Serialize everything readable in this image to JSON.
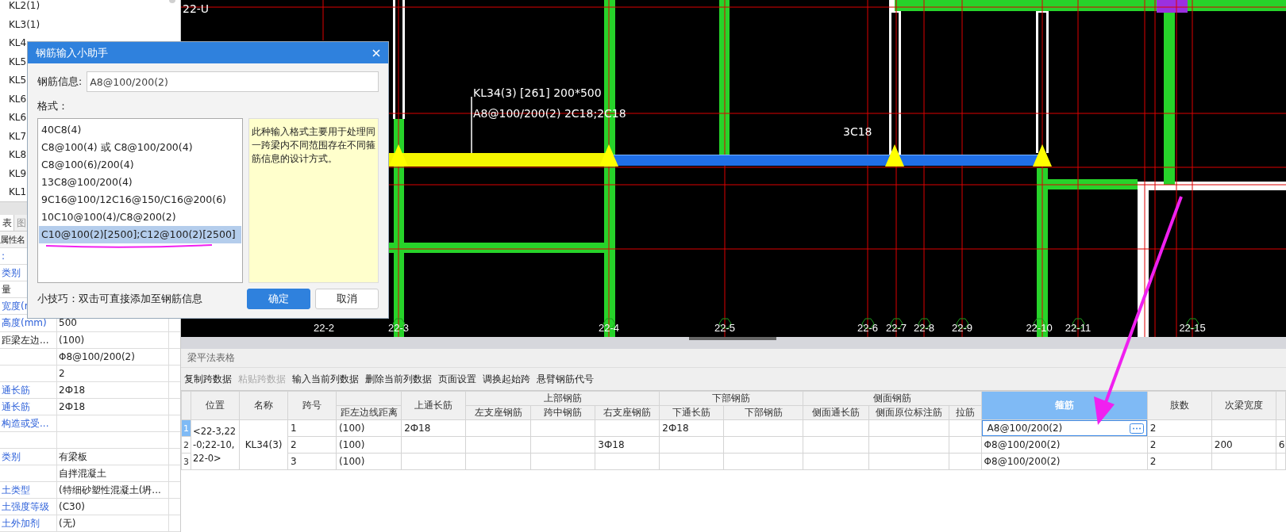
{
  "component_list": {
    "items": [
      "KL2(1)",
      "KL3(1)",
      "KL4",
      "KL5",
      "KL5",
      "KL6",
      "KL6",
      "KL7",
      "KL8",
      "KL9",
      "KL1"
    ]
  },
  "property_panel": {
    "tabs": [
      {
        "label": "表",
        "selected": true
      },
      {
        "label": "图",
        "selected": false
      }
    ],
    "header": "属性名",
    "rows": [
      {
        "name": ":",
        "public": true
      },
      {
        "name": "类别",
        "public": true
      },
      {
        "name": "量",
        "public": false
      },
      {
        "name": "宽度(r",
        "public": true
      },
      {
        "name": "高度(mm)",
        "public": true,
        "value": "500"
      },
      {
        "name": "距梁左边...",
        "public": false,
        "value": "(100)"
      },
      {
        "value": "Φ8@100/200(2)"
      },
      {
        "value": "2"
      },
      {
        "name": "通长筋",
        "public": true,
        "value": "2Ф18"
      },
      {
        "name": "通长筋",
        "public": true,
        "value": "2Ф18"
      },
      {
        "name": "构造或受...",
        "public": true
      },
      {},
      {
        "name": "类别",
        "public": true,
        "value": "有梁板"
      },
      {
        "value": "自拌混凝土"
      },
      {
        "name": "土类型",
        "public": true,
        "value": "(特细砂塑性混凝土(坍..."
      },
      {
        "name": "土强度等级",
        "public": true,
        "value": "(C30)"
      },
      {
        "name": "土外加剂",
        "public": true,
        "value": "(无)"
      }
    ]
  },
  "canvas": {
    "side_labels": [
      "22-U"
    ],
    "axis_labels": [
      "22-2",
      "22-3",
      "22-4",
      "22-5",
      "22-6",
      "22-7",
      "22-8",
      "22-9",
      "22-10",
      "22-11",
      "22-15"
    ],
    "annotations": [
      "KL34(3) [261] 200*500",
      "A8@100/200(2) 2C18;2C18",
      "3C18"
    ]
  },
  "dialog": {
    "title": "钢筋输入小助手",
    "field_label": "钢筋信息:",
    "field_value": "A8@100/200(2)",
    "format_label": "格式：",
    "formats": [
      {
        "label": "40C8(4)",
        "selected": false
      },
      {
        "label": "C8@100(4) 或 C8@100/200(4)",
        "selected": false
      },
      {
        "label": "C8@100(6)/200(4)",
        "selected": false
      },
      {
        "label": "13C8@100/200(4)",
        "selected": false
      },
      {
        "label": "9C16@100/12C16@150/C16@200(6)",
        "selected": false
      },
      {
        "label": "10C10@100(4)/C8@200(2)",
        "selected": false
      },
      {
        "label": "C10@100(2)[2500];C12@100(2)[2500]",
        "selected": true
      }
    ],
    "description": "此种输入格式主要用于处理同一跨梁内不同范围存在不同箍筋信息的设计方式。",
    "tip": "小技巧：双击可直接添加至钢筋信息",
    "buttons": [
      {
        "label": "确定",
        "kind": "primary"
      },
      {
        "label": "取消",
        "kind": "secondary"
      }
    ]
  },
  "beam_table": {
    "title": "梁平法表格",
    "toolbar": [
      {
        "label": "复制跨数据",
        "disabled": false
      },
      {
        "label": "粘贴跨数据",
        "disabled": true
      },
      {
        "label": "输入当前列数据",
        "disabled": false
      },
      {
        "label": "删除当前列数据",
        "disabled": false
      },
      {
        "label": "页面设置",
        "disabled": false
      },
      {
        "label": "调换起始跨",
        "disabled": false
      },
      {
        "label": "悬臂钢筋代号",
        "disabled": false
      }
    ],
    "header": [
      {
        "label": "位置",
        "selected": false
      },
      {
        "label": "名称",
        "selected": false
      },
      {
        "label": "跨号",
        "selected": false
      },
      {
        "children": [
          {
            "label": "距左边线距离",
            "selected": false
          }
        ]
      },
      {
        "label": "上通长筋",
        "selected": false
      },
      {
        "label": "上部钢筋",
        "children": [
          {
            "label": "左支座钢筋",
            "selected": false
          },
          {
            "label": "跨中钢筋",
            "selected": false
          },
          {
            "label": "右支座钢筋",
            "selected": false
          }
        ]
      },
      {
        "label": "下部钢筋",
        "children": [
          {
            "label": "下通长筋",
            "selected": false
          },
          {
            "label": "下部钢筋",
            "selected": false
          }
        ]
      },
      {
        "label": "侧面钢筋",
        "children": [
          {
            "label": "侧面通长筋",
            "selected": false
          },
          {
            "label": "侧面原位标注筋",
            "selected": false
          },
          {
            "label": "拉筋",
            "selected": false
          }
        ]
      },
      {
        "label": "箍筋",
        "selected": true
      },
      {
        "label": "肢数",
        "selected": false
      },
      {
        "label": "次梁宽度",
        "selected": false
      },
      {
        "selected": false
      }
    ],
    "beam": {
      "location": "<22-3,22-0;22-10,22-0>",
      "name": "KL34(3)"
    },
    "rows": [
      {
        "row_number": "1",
        "selected": true,
        "cells": [
          "1",
          "(100)",
          "2Ф18",
          null,
          null,
          null,
          "2Ф18",
          null,
          null,
          null,
          null,
          "A8@100/200(2)",
          "2",
          null,
          null
        ]
      },
      {
        "row_number": "2",
        "selected": false,
        "cells": [
          "2",
          "(100)",
          null,
          null,
          null,
          "3Ф18",
          null,
          null,
          null,
          null,
          null,
          "Φ8@100/200(2)",
          "2",
          "200",
          "6"
        ]
      },
      {
        "row_number": "3",
        "selected": false,
        "cells": [
          "3",
          "(100)",
          null,
          null,
          null,
          null,
          null,
          null,
          null,
          null,
          null,
          "Φ8@100/200(2)",
          "2",
          null,
          null
        ]
      }
    ]
  }
}
